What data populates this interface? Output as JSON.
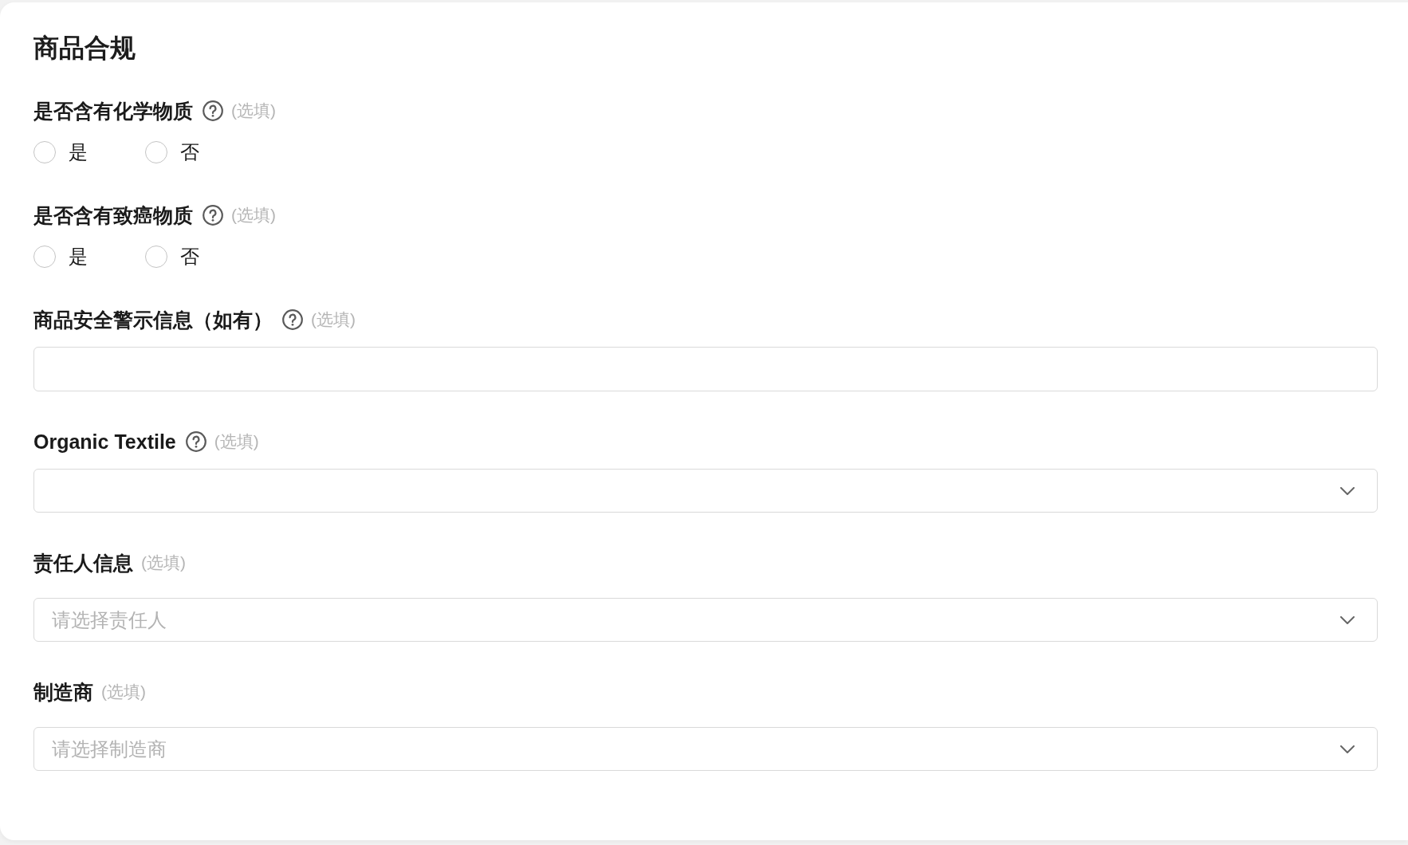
{
  "section": {
    "title": "商品合规"
  },
  "fields": [
    {
      "kind": "radio",
      "label": "是否含有化学物质",
      "has_help": true,
      "optional_tag": "(选填)",
      "options": [
        {
          "label": "是",
          "selected": false
        },
        {
          "label": "否",
          "selected": false
        }
      ]
    },
    {
      "kind": "radio",
      "label": "是否含有致癌物质",
      "has_help": true,
      "optional_tag": "(选填)",
      "options": [
        {
          "label": "是",
          "selected": false
        },
        {
          "label": "否",
          "selected": false
        }
      ]
    },
    {
      "kind": "text",
      "label": "商品安全警示信息（如有）",
      "has_help": true,
      "optional_tag": "(选填)"
    },
    {
      "kind": "select",
      "label": "Organic Textile",
      "has_help": true,
      "optional_tag": "(选填)"
    },
    {
      "kind": "select",
      "label": "责任人信息",
      "has_help": false,
      "optional_tag": "(选填)",
      "placeholder": "请选择责任人"
    },
    {
      "kind": "select",
      "label": "制造商",
      "has_help": false,
      "optional_tag": "(选填)",
      "placeholder": "请选择制造商"
    }
  ]
}
